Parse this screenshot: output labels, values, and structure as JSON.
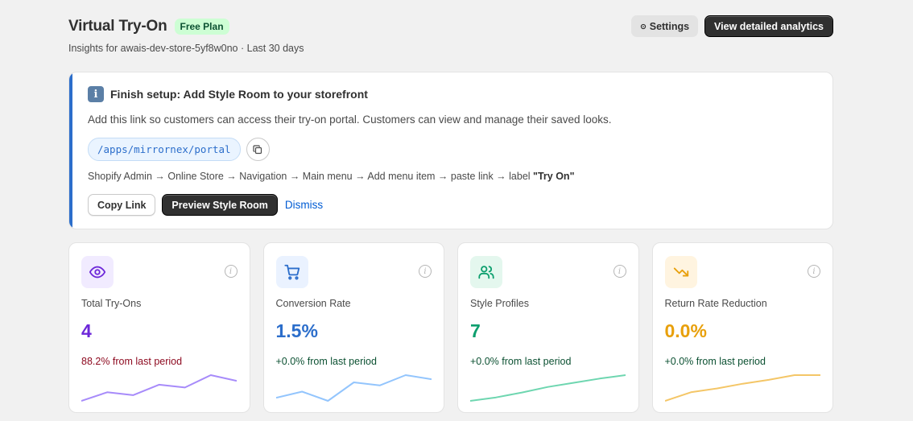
{
  "header": {
    "title": "Virtual Try-On",
    "plan_badge": "Free Plan",
    "subtitle": "Insights for awais-dev-store-5yf8w0no · Last 30 days",
    "settings_label": "Settings",
    "settings_icon": "gear-icon",
    "analytics_label": "View detailed analytics"
  },
  "setup": {
    "icon": "info-icon",
    "icon_glyph": "i",
    "title": "Finish setup: Add Style Room to your storefront",
    "description": "Add this link so customers can access their try-on portal. Customers can view and manage their saved looks.",
    "link": "/apps/mirrornex/portal",
    "instructions_prefix": "Shopify Admin → Online Store → Navigation → Main menu → Add menu item → paste link → label ",
    "instructions_label": "\"Try On\"",
    "copy_label": "Copy Link",
    "preview_label": "Preview Style Room",
    "dismiss_label": "Dismiss",
    "accent_color": "#2c6ecb"
  },
  "stats": [
    {
      "label": "Total Try-Ons",
      "value": "4",
      "change": "88.2% from last period",
      "icon": "eye-icon",
      "color": "#6d28d9",
      "bg": "#f1ebff",
      "change_color": "#8e0b21",
      "line_color": "#a78bfa",
      "trend": [
        0.1,
        0.55,
        0.4,
        0.95,
        0.8,
        1.45,
        1.15
      ]
    },
    {
      "label": "Conversion Rate",
      "value": "1.5%",
      "change": "+0.0% from last period",
      "icon": "cart-icon",
      "color": "#2c6ecb",
      "bg": "#eaf2ff",
      "change_color": "#0c5132",
      "line_color": "#93c5fd",
      "trend": [
        0.2,
        0.5,
        0.05,
        0.95,
        0.8,
        1.3,
        1.1
      ]
    },
    {
      "label": "Style Profiles",
      "value": "7",
      "change": "+0.0% from last period",
      "icon": "users-icon",
      "color": "#0e9f6e",
      "bg": "#e4f7ee",
      "change_color": "#0c5132",
      "line_color": "#6ed6b0",
      "trend": [
        0.05,
        0.3,
        0.65,
        1.05,
        1.35,
        1.65,
        1.9
      ]
    },
    {
      "label": "Return Rate Reduction",
      "value": "0.0%",
      "change": "+0.0% from last period",
      "icon": "trending-down-icon",
      "color": "#e8a00c",
      "bg": "#fff4e0",
      "change_color": "#0c5132",
      "line_color": "#f4c667",
      "trend": [
        0.1,
        0.55,
        0.75,
        1.0,
        1.2,
        1.45,
        1.45
      ]
    }
  ]
}
